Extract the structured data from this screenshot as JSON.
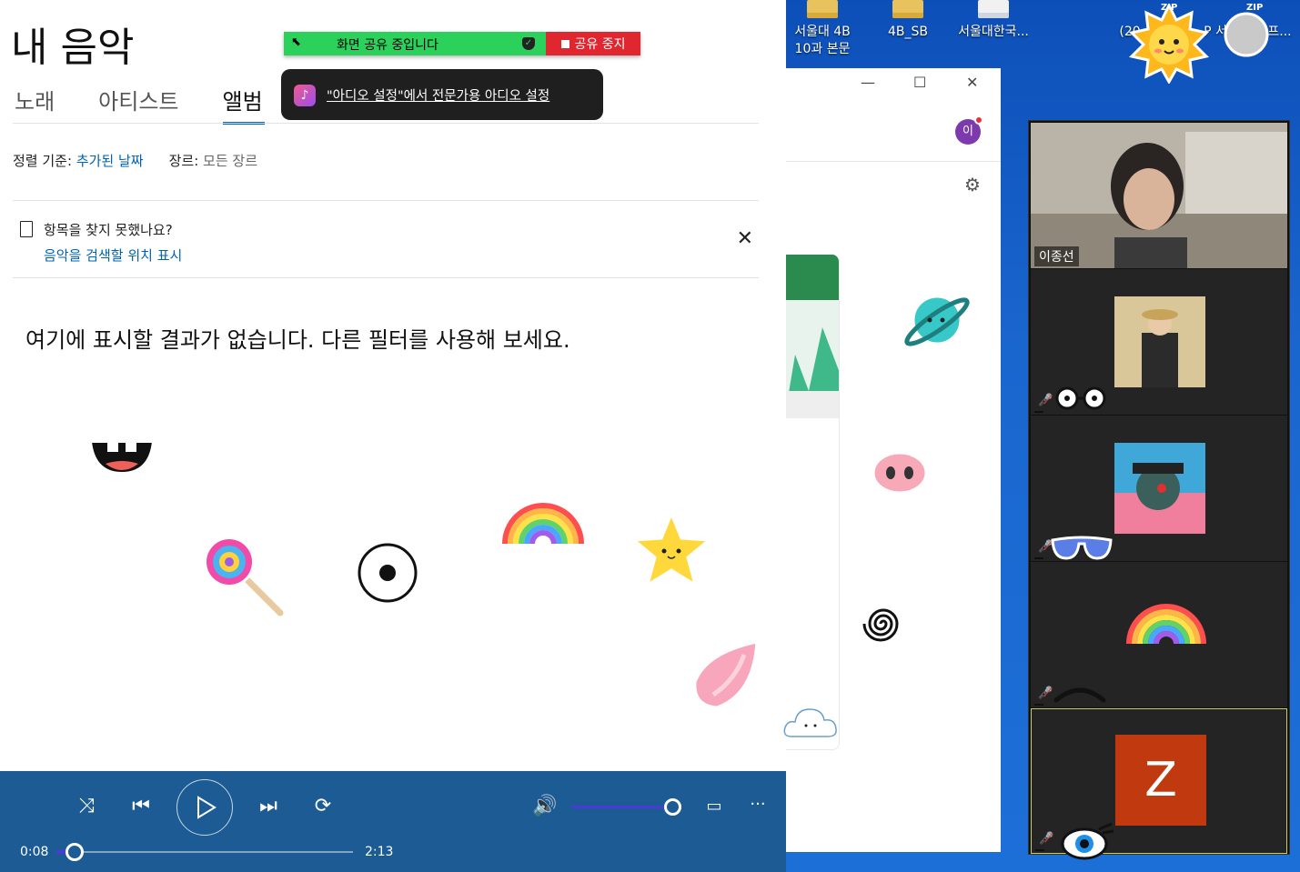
{
  "desktop": {
    "icons": [
      {
        "label": "서울대 4B\n10과 본문"
      },
      {
        "label": "4B_SB"
      },
      {
        "label": "서울대한국..."
      },
      {
        "label": "(20"
      },
      {
        "label": "P 서"
      },
      {
        "label": "프..."
      }
    ],
    "zip_label": "ZIP"
  },
  "music": {
    "title": "내 음악",
    "tabs": [
      {
        "label": "노래"
      },
      {
        "label": "아티스트"
      },
      {
        "label": "앨범"
      }
    ],
    "sort_label": "정렬 기준:",
    "sort_value": "추가된 날짜",
    "genre_label": "장르:",
    "genre_value": "모든 장르",
    "notice_text": "항목을 찾지 못했나요?",
    "notice_link": "음악을 검색할 위치 표시",
    "notice_close": "✕",
    "empty_message": "여기에 표시할 결과가 없습니다. 다른 필터를 사용해 보세요."
  },
  "share_bar": {
    "status": "화면 공유 중입니다",
    "stop": "공유 중지"
  },
  "toast": {
    "text": "\"아디오 설정\"에서 전문가용 아디오 설정"
  },
  "player": {
    "current_time": "0:08",
    "total_time": "2:13",
    "progress": 0.06,
    "volume": 1.0,
    "more": "···"
  },
  "mid_window": {
    "avatar": "이"
  },
  "video": {
    "tiles": [
      {
        "name": "이종선"
      },
      {
        "name": ""
      },
      {
        "name": ""
      },
      {
        "name": ""
      },
      {
        "name": "",
        "avatar_letter": "Z"
      }
    ]
  },
  "colors": {
    "accent": "#0063b1",
    "player_bg": "#1c5b93",
    "share_green": "#2bd15b",
    "share_red": "#e0262f"
  }
}
